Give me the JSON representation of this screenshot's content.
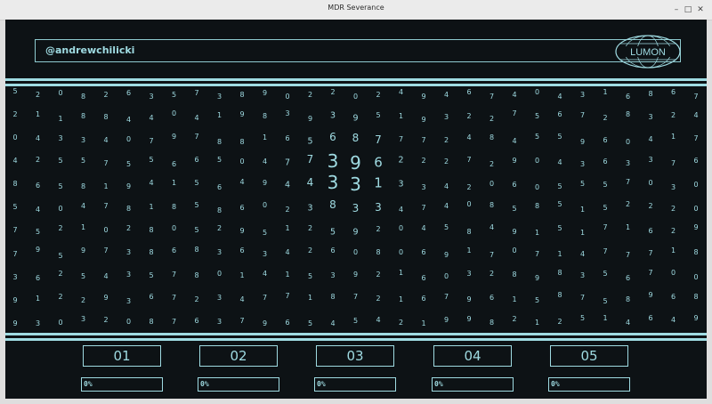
{
  "window": {
    "title": "MDR Severance",
    "minimize": "–",
    "maximize": "□",
    "close": "✕"
  },
  "header": {
    "username": "@andrewchilicki",
    "logo_text": "LUMON"
  },
  "grid": {
    "rows": [
      "5208263573890220249467404316867",
      "2118844041983939519322756728324",
      "0433407978816568777248455960417",
      "4255755665047739622272904363376",
      "8658194156494433133420605557030",
      "5404781858602383347408585152220",
      "7521028052951259204584915171629",
      "7959738683634260806917071477718",
      "3625435780141539216032898356700",
      "9122936723477187216796158758968",
      "9303208763796545421998212514649"
    ]
  },
  "bins": [
    {
      "label": "01",
      "progress_label": "0%",
      "progress": 0
    },
    {
      "label": "02",
      "progress_label": "0%",
      "progress": 0
    },
    {
      "label": "03",
      "progress_label": "0%",
      "progress": 0
    },
    {
      "label": "04",
      "progress_label": "0%",
      "progress": 0
    },
    {
      "label": "05",
      "progress_label": "0%",
      "progress": 0
    }
  ],
  "colors": {
    "accent": "#9fdbe2",
    "background": "#0d1215"
  }
}
